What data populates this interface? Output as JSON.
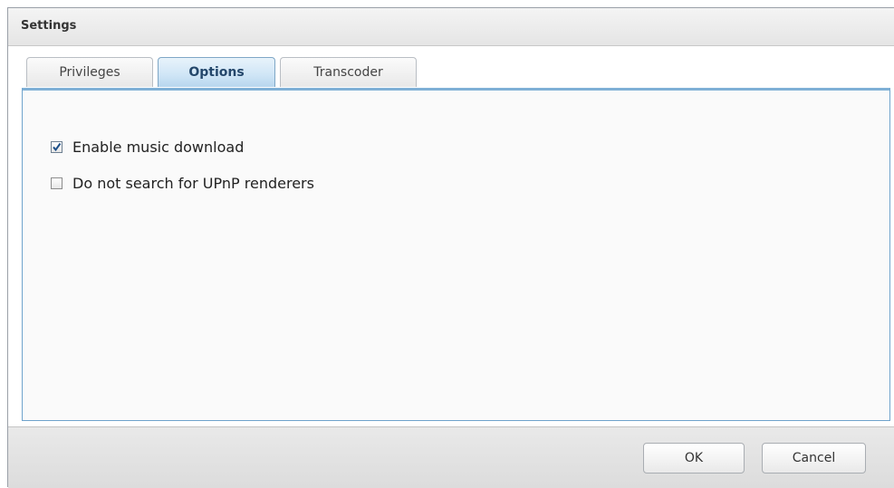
{
  "dialog": {
    "title": "Settings"
  },
  "tabs": [
    {
      "label": "Privileges",
      "active": false
    },
    {
      "label": "Options",
      "active": true
    },
    {
      "label": "Transcoder",
      "active": false
    }
  ],
  "options": [
    {
      "label": "Enable music download",
      "checked": true
    },
    {
      "label": "Do not search for UPnP renderers",
      "checked": false
    }
  ],
  "buttons": {
    "ok": "OK",
    "cancel": "Cancel"
  },
  "colors": {
    "active_tab": "#cfe5f6",
    "panel_border": "#6fa3cc",
    "checkmark": "#1c4f8a"
  },
  "icons": {
    "checked_box": "checkbox-checked-icon",
    "unchecked_box": "checkbox-unchecked-icon"
  }
}
